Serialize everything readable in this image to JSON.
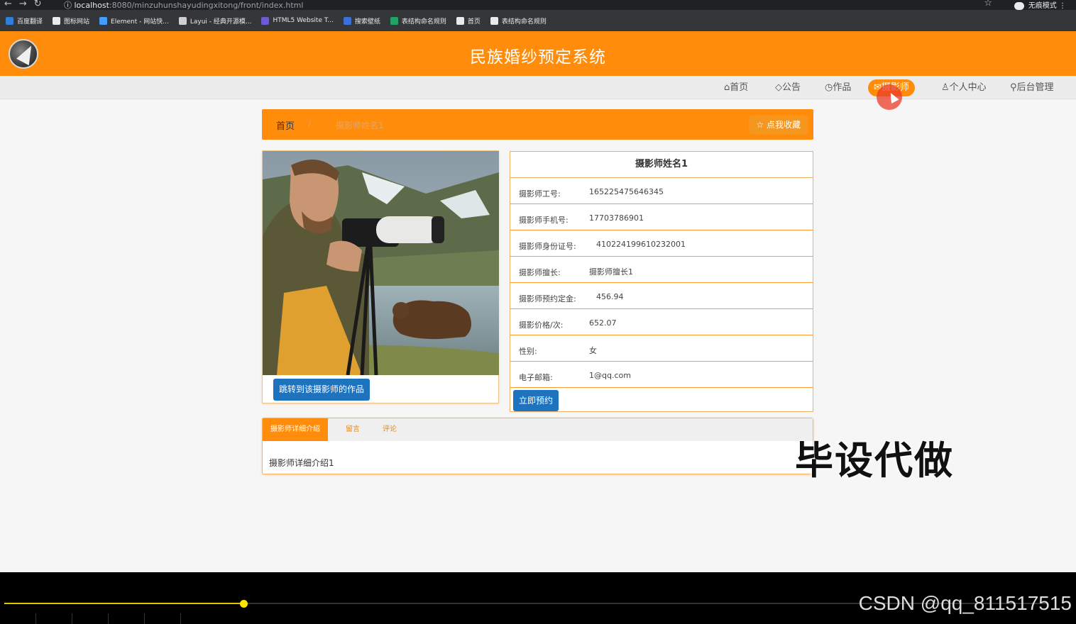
{
  "browser": {
    "url_host": "localhost",
    "url_path": ":8080/minzuhunshayudingxitong/front/index.html",
    "mode_label": "无痕模式",
    "bookmarks": [
      {
        "label": "百度翻译",
        "color": "#2d7fd8"
      },
      {
        "label": "图标网站",
        "color": "#e8eaed"
      },
      {
        "label": "Element - 网站快...",
        "color": "#409eff"
      },
      {
        "label": "Layui - 经典开源模...",
        "color": "#cfcfcf"
      },
      {
        "label": "HTML5 Website T...",
        "color": "#6b5bd2"
      },
      {
        "label": "搜索壁纸",
        "color": "#3c6fd8"
      },
      {
        "label": "表结构命名规则",
        "color": "#21a366"
      },
      {
        "label": "首页",
        "color": "#e8eaed"
      },
      {
        "label": "表结构命名规则",
        "color": "#e8eaed"
      }
    ]
  },
  "site": {
    "title": "民族婚纱预定系统",
    "nav": [
      {
        "label": "首页",
        "icon": "home-icon"
      },
      {
        "label": "公告",
        "icon": "tag-icon"
      },
      {
        "label": "作品",
        "icon": "clock-icon"
      },
      {
        "label": "摄影师",
        "icon": "mail-icon",
        "active": true
      },
      {
        "label": "个人中心",
        "icon": "user-icon"
      },
      {
        "label": "后台管理",
        "icon": "link-icon"
      }
    ]
  },
  "breadcrumb": {
    "home": "首页",
    "separator": "/",
    "current": "摄影师姓名1",
    "favorite_label": "点我收藏"
  },
  "photographer": {
    "name": "摄影师姓名1",
    "jump_button": "跳转到该摄影师的作品",
    "book_button": "立即预约",
    "fields": [
      {
        "label": "摄影师工号:",
        "value": "165225475646345"
      },
      {
        "label": "摄影师手机号:",
        "value": "17703786901"
      },
      {
        "label": "摄影师身份证号:",
        "value": "410224199610232001"
      },
      {
        "label": "摄影师擅长:",
        "value": "摄影师擅长1"
      },
      {
        "label": "摄影师预约定金:",
        "value": "456.94"
      },
      {
        "label": "摄影价格/次:",
        "value": "652.07"
      },
      {
        "label": "性别:",
        "value": "女"
      },
      {
        "label": "电子邮箱:",
        "value": "1@qq.com"
      }
    ]
  },
  "tabs": {
    "items": [
      "摄影师详细介绍",
      "留言",
      "评论"
    ],
    "active_index": 0,
    "content": "摄影师详细介绍1"
  },
  "overlay": {
    "watermark": "毕设代做",
    "csdn": "CSDN @qq_811517515"
  },
  "player": {
    "progress": 0.229
  }
}
